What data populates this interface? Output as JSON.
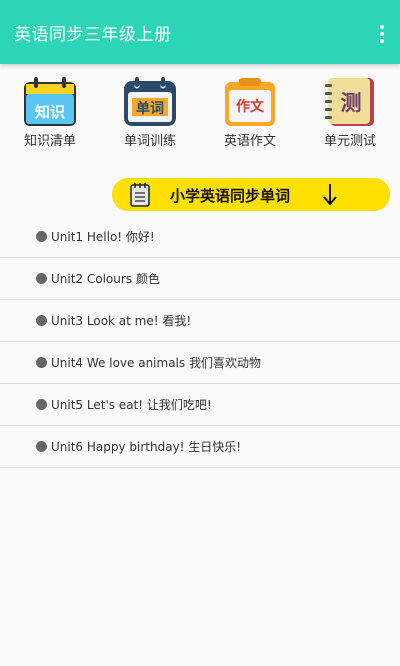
{
  "appbar": {
    "title": "英语同步三年级上册"
  },
  "shortcuts": [
    {
      "label": "知识清单",
      "icon_text": "知识",
      "icon": "knowledge-list-icon"
    },
    {
      "label": "单词训练",
      "icon_text": "单词",
      "icon": "word-practice-icon"
    },
    {
      "label": "英语作文",
      "icon_text": "作文",
      "icon": "composition-icon"
    },
    {
      "label": "单元测试",
      "icon_text": "测",
      "icon": "unit-test-icon"
    }
  ],
  "banner": {
    "text": "小学英语同步单词"
  },
  "units": [
    {
      "label": "Unit1 Hello! 你好!"
    },
    {
      "label": "Unit2 Colours 颜色"
    },
    {
      "label": "Unit3 Look at me! 看我!"
    },
    {
      "label": "Unit4 We love animals 我们喜欢动物"
    },
    {
      "label": "Unit5 Let's eat! 让我们吃吧!"
    },
    {
      "label": "Unit6 Happy birthday! 生日快乐!"
    }
  ],
  "colors": {
    "appbar": "#2bd5b5",
    "banner": "#ffe000"
  }
}
